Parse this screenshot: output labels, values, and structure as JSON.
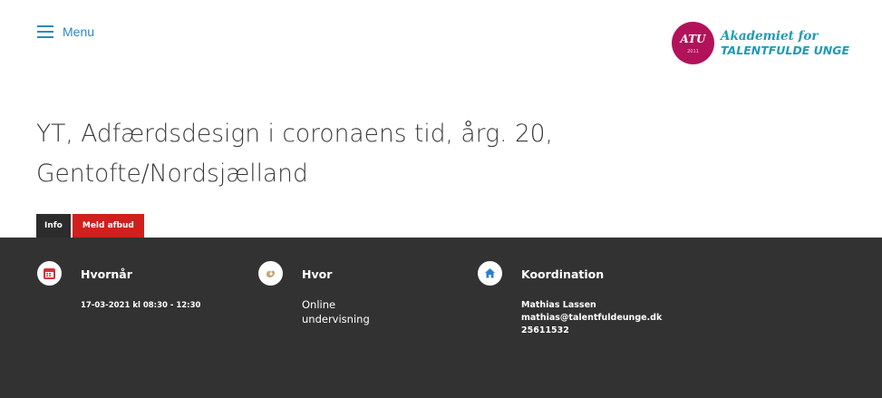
{
  "header": {
    "menu_label": "Menu",
    "logo": {
      "monogram": "ATU",
      "year": "2011",
      "line1": "Akademiet for",
      "line2": "TALENTFULDE UNGE",
      "color": "#b2125a",
      "text_color": "#1f9bb5"
    }
  },
  "page": {
    "title_line1": "YT, Adfærdsdesign i coronaens tid, årg. 20,",
    "title_line2": "Gentofte/Nordsjælland"
  },
  "tabs": [
    {
      "label": "Info",
      "active": true,
      "color": "#2c2c2c"
    },
    {
      "label": "Meld afbud",
      "active": false,
      "color": "#d0201d"
    }
  ],
  "details": {
    "when": {
      "icon": "calendar-icon",
      "title": "Hvornår",
      "value": "17-03-2021 kl 08:30 - 12:30"
    },
    "where": {
      "icon": "location-icon",
      "title": "Hvor",
      "line1": "Online",
      "line2": "undervisning"
    },
    "coordination": {
      "icon": "home-icon",
      "title": "Koordination",
      "name": "Mathias Lassen",
      "email": "mathias@talentfuldeunge.dk",
      "phone": "25611532"
    }
  },
  "colors": {
    "accent_blue": "#2a88c6",
    "panel_bg": "#323232",
    "icon_red": "#d8303a",
    "icon_tan": "#c2a56e",
    "icon_blue": "#2a7fd0"
  }
}
